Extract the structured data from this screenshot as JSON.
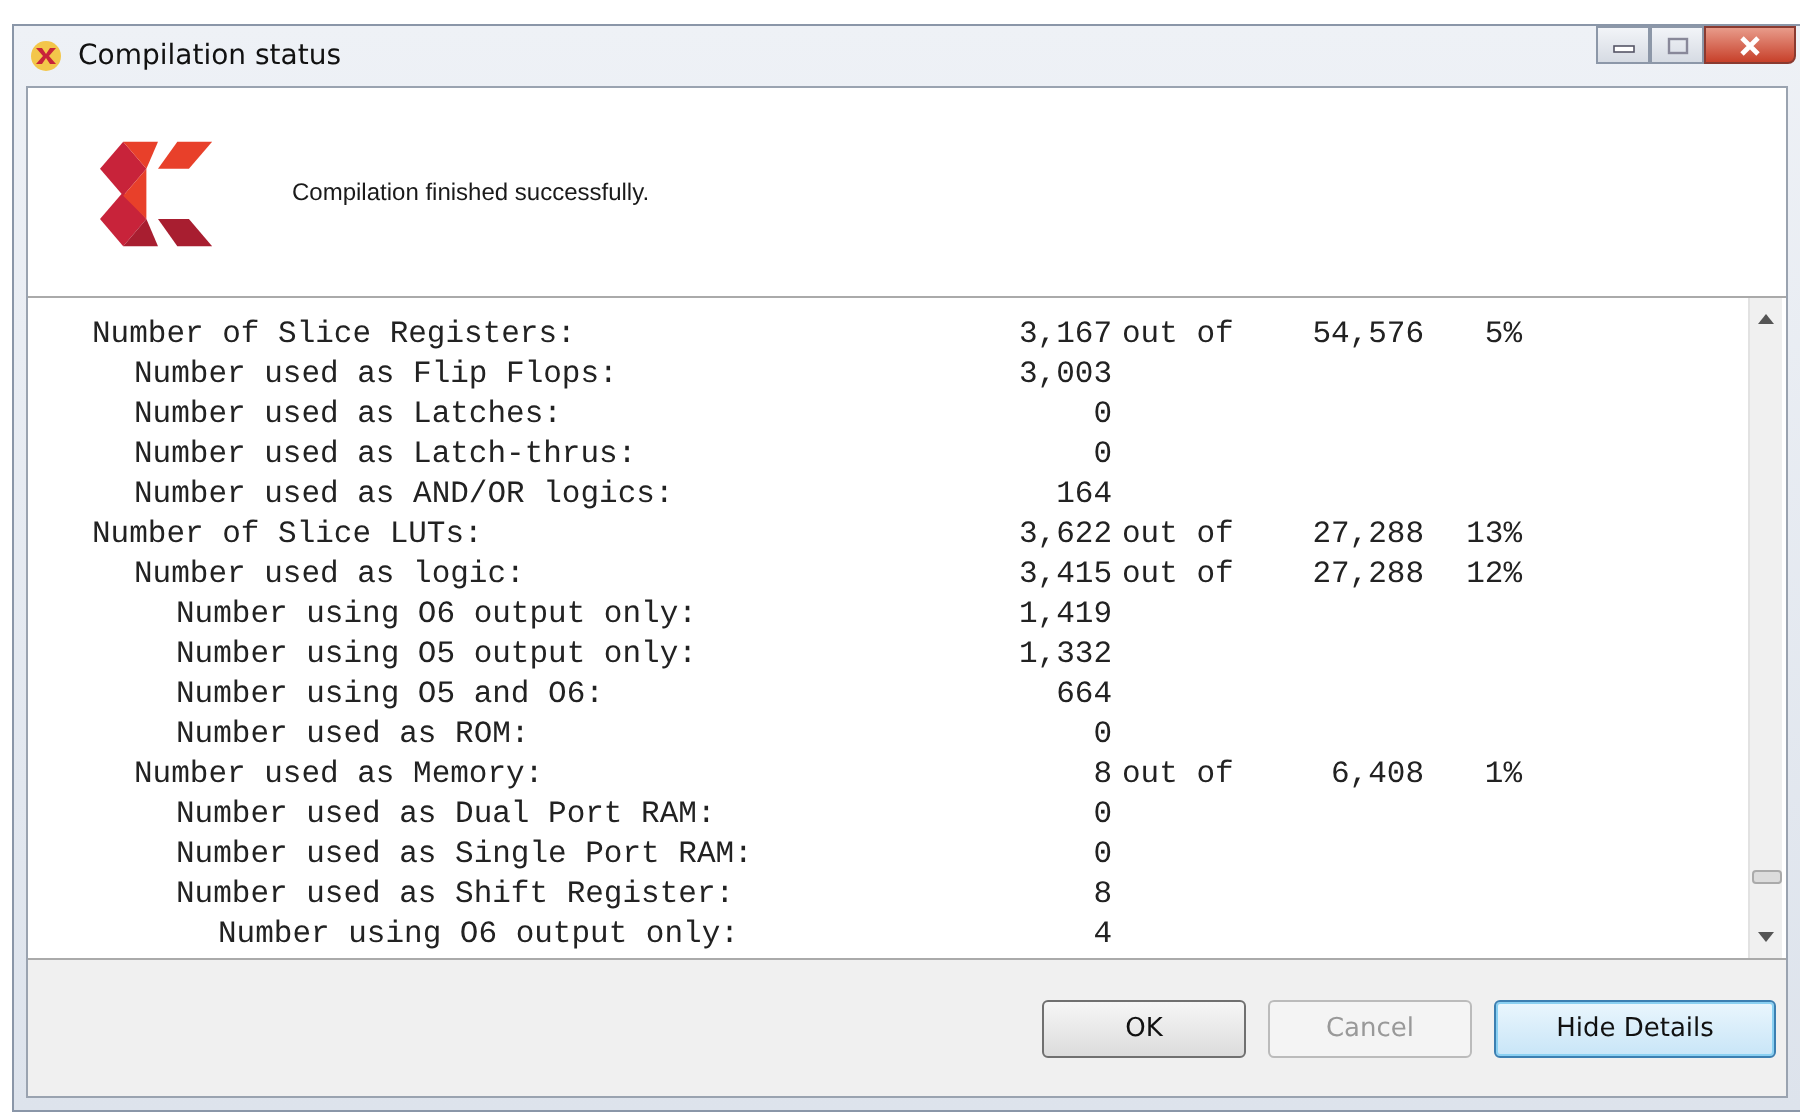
{
  "window": {
    "title": "Compilation status"
  },
  "message": "Compilation finished successfully.",
  "rows": [
    {
      "label": "Number of Slice Registers:",
      "value": "3,167",
      "out_of": "out of",
      "total": "54,576",
      "percent": "5%",
      "children": [
        {
          "label": "Number used as Flip Flops:",
          "value": "3,003"
        },
        {
          "label": "Number used as Latches:",
          "value": "0"
        },
        {
          "label": "Number used as Latch-thrus:",
          "value": "0"
        },
        {
          "label": "Number used as AND/OR logics:",
          "value": "164"
        }
      ]
    },
    {
      "label": "Number of Slice LUTs:",
      "value": "3,622",
      "out_of": "out of",
      "total": "27,288",
      "percent": "13%",
      "children": [
        {
          "label": "Number used as logic:",
          "value": "3,415",
          "out_of": "out of",
          "total": "27,288",
          "percent": "12%",
          "children": [
            {
              "label": "Number using O6 output only:",
              "value": "1,419"
            },
            {
              "label": "Number using O5 output only:",
              "value": "1,332"
            },
            {
              "label": "Number using O5 and O6:",
              "value": "664"
            },
            {
              "label": "Number used as ROM:",
              "value": "0"
            }
          ]
        },
        {
          "label": "Number used as Memory:",
          "value": "8",
          "out_of": "out of",
          "total": "6,408",
          "percent": "1%",
          "children": [
            {
              "label": "Number used as Dual Port RAM:",
              "value": "0"
            },
            {
              "label": "Number used as Single Port RAM:",
              "value": "0"
            },
            {
              "label": "Number used as Shift Register:",
              "value": "8",
              "children": [
                {
                  "label": "Number using O6 output only:",
                  "value": "4"
                }
              ]
            }
          ]
        }
      ]
    }
  ],
  "buttons": [
    {
      "label": "OK",
      "disabled": false,
      "focused": false
    },
    {
      "label": "Cancel",
      "disabled": true,
      "focused": false
    },
    {
      "label": "Hide Details",
      "disabled": false,
      "focused": true
    }
  ]
}
